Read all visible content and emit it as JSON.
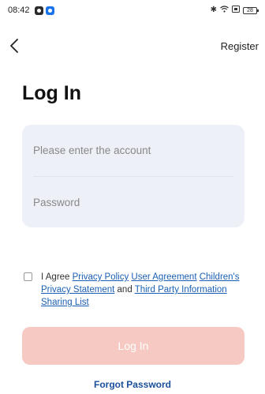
{
  "status_bar": {
    "time": "08:42",
    "battery": "28"
  },
  "nav": {
    "register": "Register"
  },
  "title": "Log In",
  "form": {
    "account_placeholder": "Please enter the account",
    "password_placeholder": "Password"
  },
  "agreement": {
    "prefix": "I Agree ",
    "privacy_policy": "Privacy Policy",
    "user_agreement": "User Agreement",
    "children_privacy": "Children's Privacy Statement",
    "and": " and ",
    "third_party": "Third Party Information Sharing List"
  },
  "login_button": "Log In",
  "forgot_password": "Forgot Password",
  "colors": {
    "accent_link": "#1a5fb4",
    "login_button_bg": "#f7c9c3",
    "input_card_bg": "#eef0f7"
  }
}
